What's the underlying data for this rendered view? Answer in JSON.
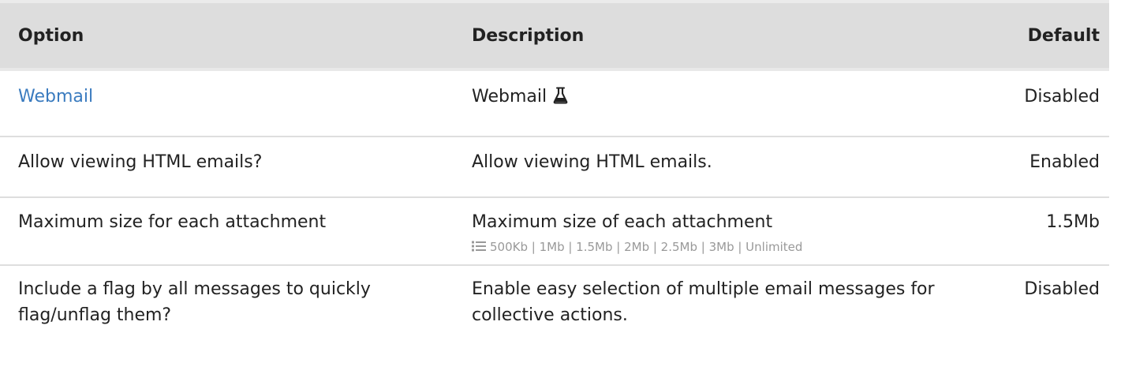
{
  "table": {
    "headers": {
      "option": "Option",
      "description": "Description",
      "default": "Default"
    },
    "rows": [
      {
        "option": "Webmail",
        "description": "Webmail",
        "default": "Disabled",
        "option_is_link": true,
        "icon": "flask-icon"
      },
      {
        "option": "Allow viewing HTML emails?",
        "description": "Allow viewing HTML emails.",
        "default": "Enabled"
      },
      {
        "option": "Maximum size for each attachment",
        "description": "Maximum size of each attachment",
        "default": "1.5Mb",
        "choices": "500Kb | 1Mb | 1.5Mb | 2Mb | 2.5Mb | 3Mb | Unlimited",
        "choices_icon": "list-icon"
      },
      {
        "option": "Include a flag by all messages to quickly flag/unflag them?",
        "description": "Enable easy selection of multiple email messages for collective actions.",
        "default": "Disabled"
      }
    ]
  },
  "colors": {
    "link": "#3a7bbf",
    "header_bg": "#dddddd",
    "muted": "#999999"
  }
}
